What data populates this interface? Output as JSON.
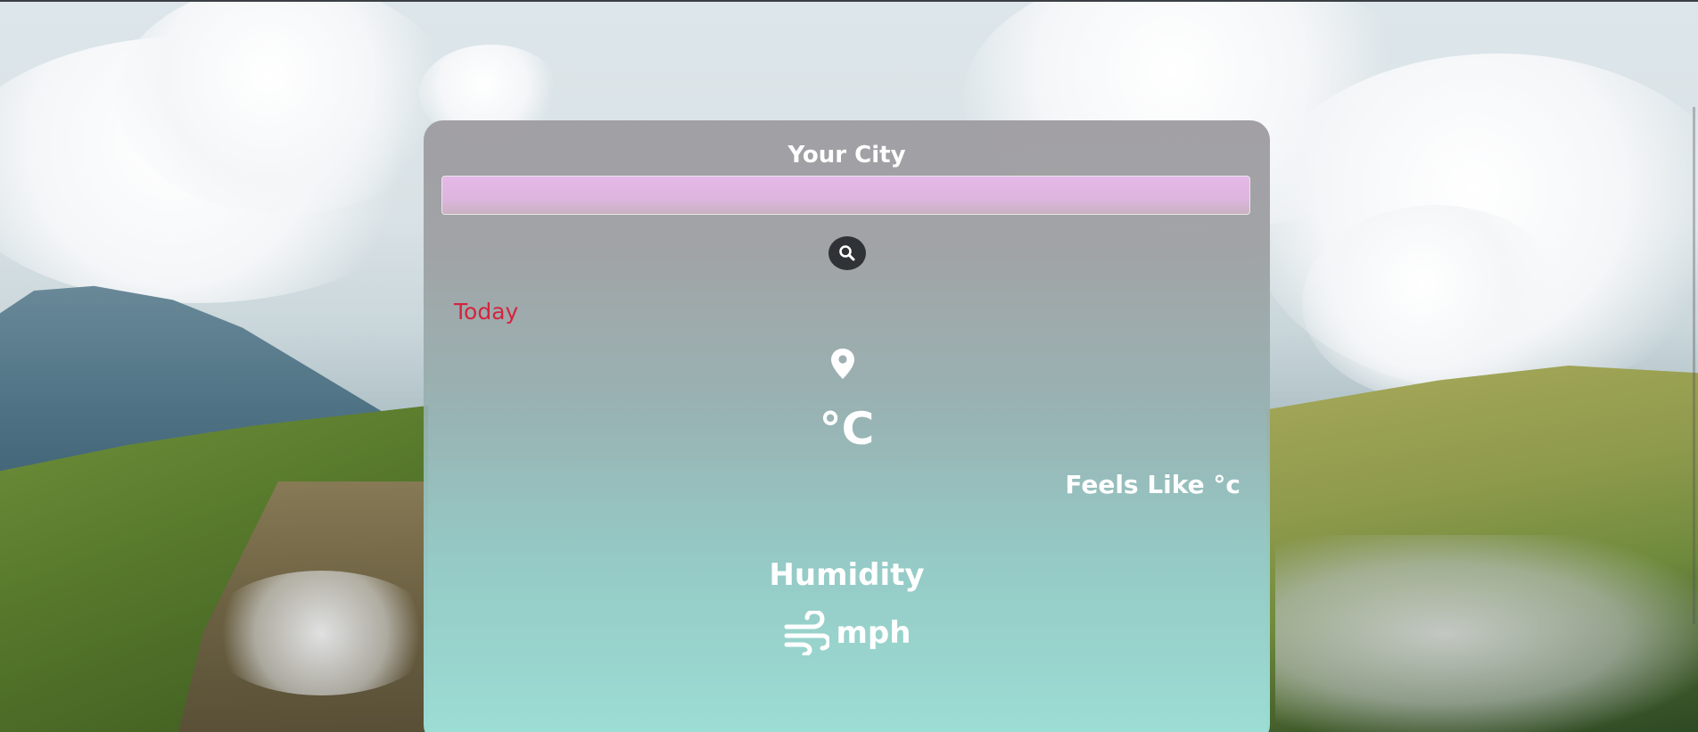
{
  "header": {
    "city_label": "Your City"
  },
  "search": {
    "value": "",
    "placeholder": "",
    "icon": "search-icon"
  },
  "weather": {
    "day_label": "Today",
    "location_icon": "map-pin-icon",
    "temperature": "°C",
    "feels_like": "Feels Like °c",
    "humidity": "Humidity",
    "wind_icon": "wind-icon",
    "wind_unit": "mph"
  },
  "colors": {
    "today_text": "#d4243f",
    "search_button_bg": "#2f3337",
    "input_bg": "#e6b8e8",
    "card_top": "#a09ea3",
    "card_bottom": "#a0e4de"
  }
}
